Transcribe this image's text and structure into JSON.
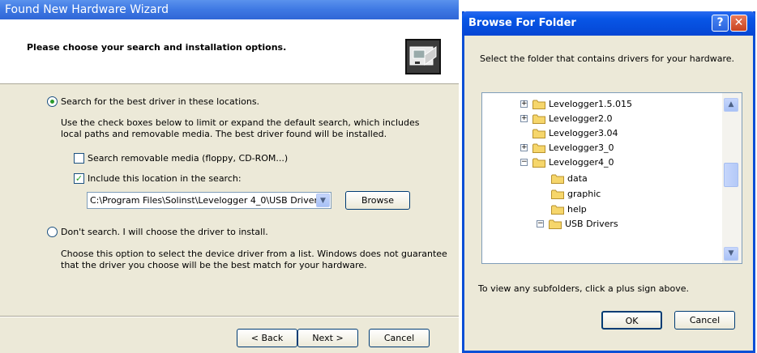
{
  "wizard": {
    "title": "Found New Hardware Wizard",
    "heading": "Please choose your search and installation options.",
    "option_search_label": "Search for the best driver in these locations.",
    "option_search_desc": "Use the check boxes below to limit or expand the default search, which includes local paths and removable media. The best driver found will be installed.",
    "chk_removable_label": "Search removable media (floppy, CD-ROM...)",
    "chk_removable_checked": false,
    "chk_include_label": "Include this location in the search:",
    "chk_include_checked": true,
    "location_value": "C:\\Program Files\\Solinst\\Levelogger 4_0\\USB Driver",
    "browse_label": "Browse",
    "option_dont_label": "Don't search. I will choose the driver to install.",
    "option_dont_desc": "Choose this option to select the device driver from a list.  Windows does not guarantee that the driver you choose will be the best match for your hardware.",
    "selected_option": "search",
    "back_label": "< Back",
    "next_label": "Next >",
    "cancel_label": "Cancel"
  },
  "browse": {
    "title": "Browse For Folder",
    "help_glyph": "?",
    "close_glyph": "✕",
    "instruction": "Select the folder that contains drivers for your hardware.",
    "tree": [
      {
        "label": "Levelogger1.5.015",
        "expander": "+"
      },
      {
        "label": "Levelogger2.0",
        "expander": "+"
      },
      {
        "label": "Levelogger3.04",
        "expander": ""
      },
      {
        "label": "Levelogger3_0",
        "expander": "+"
      },
      {
        "label": "Levelogger4_0",
        "expander": "−"
      },
      {
        "label": "data",
        "expander": ""
      },
      {
        "label": "graphic",
        "expander": ""
      },
      {
        "label": "help",
        "expander": ""
      },
      {
        "label": "USB Drivers",
        "expander": "−"
      }
    ],
    "hint": "To view any subfolders, click a plus sign above.",
    "ok_label": "OK",
    "cancel_label": "Cancel"
  },
  "colors": {
    "titlebar": "#2f66d6",
    "dialog_bg": "#ece9d8",
    "folder": "#f6d66b"
  }
}
